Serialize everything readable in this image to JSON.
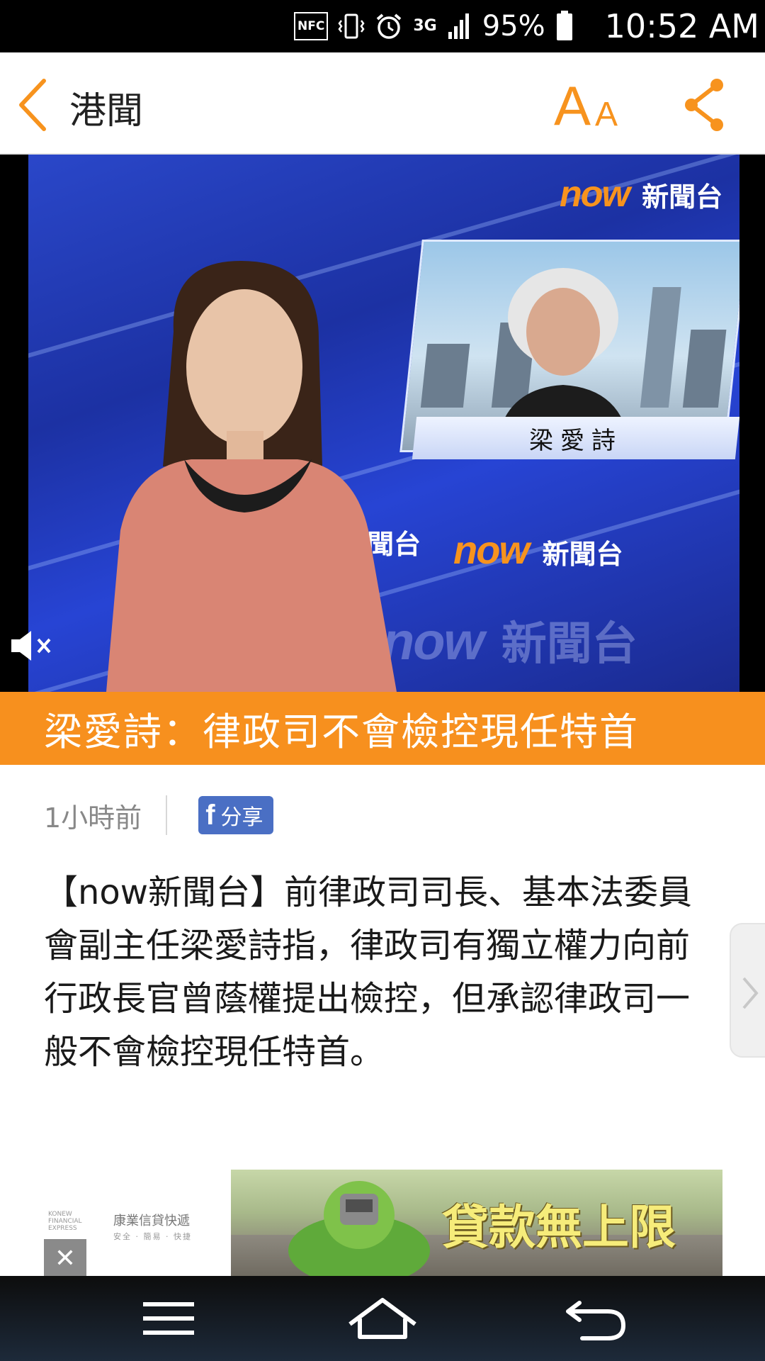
{
  "status_bar": {
    "nfc_label": "NFC",
    "network": "3G",
    "battery_percent": "95%",
    "time": "10:52 AM",
    "icons": [
      "nfc-icon",
      "vibrate-icon",
      "alarm-icon",
      "data-arrows-icon",
      "signal-icon",
      "battery-icon"
    ]
  },
  "header": {
    "title": "港聞",
    "font_size_big": "A",
    "font_size_small": "A",
    "accent_color": "#f7931e"
  },
  "video": {
    "channel_logo_now": "now",
    "channel_logo_zh": "新聞台",
    "guest_name": "梁愛詩",
    "mute_icon": "speaker-muted-icon"
  },
  "article": {
    "headline": "梁愛詩：律政司不會檢控現任特首",
    "headline_bg": "#f7901e",
    "time_ago": "1小時前",
    "share_label": "分享",
    "share_icon_letter": "f",
    "body": "【now新聞台】前律政司司長、基本法委員會副主任梁愛詩指，律政司有獨立權力向前行政長官曾蔭權提出檢控，但承認律政司一般不會檢控現任特首。"
  },
  "ad": {
    "slogan": "貸款無上限",
    "brand_zh": "康業信貸快遞",
    "brand_en": "KONEW FINANCIAL EXPRESS",
    "brand_tagline": "安全 · 簡易 · 快捷",
    "close_label": "✕"
  },
  "nav_bar": {
    "icons": [
      "menu-icon",
      "home-icon",
      "back-icon"
    ]
  }
}
